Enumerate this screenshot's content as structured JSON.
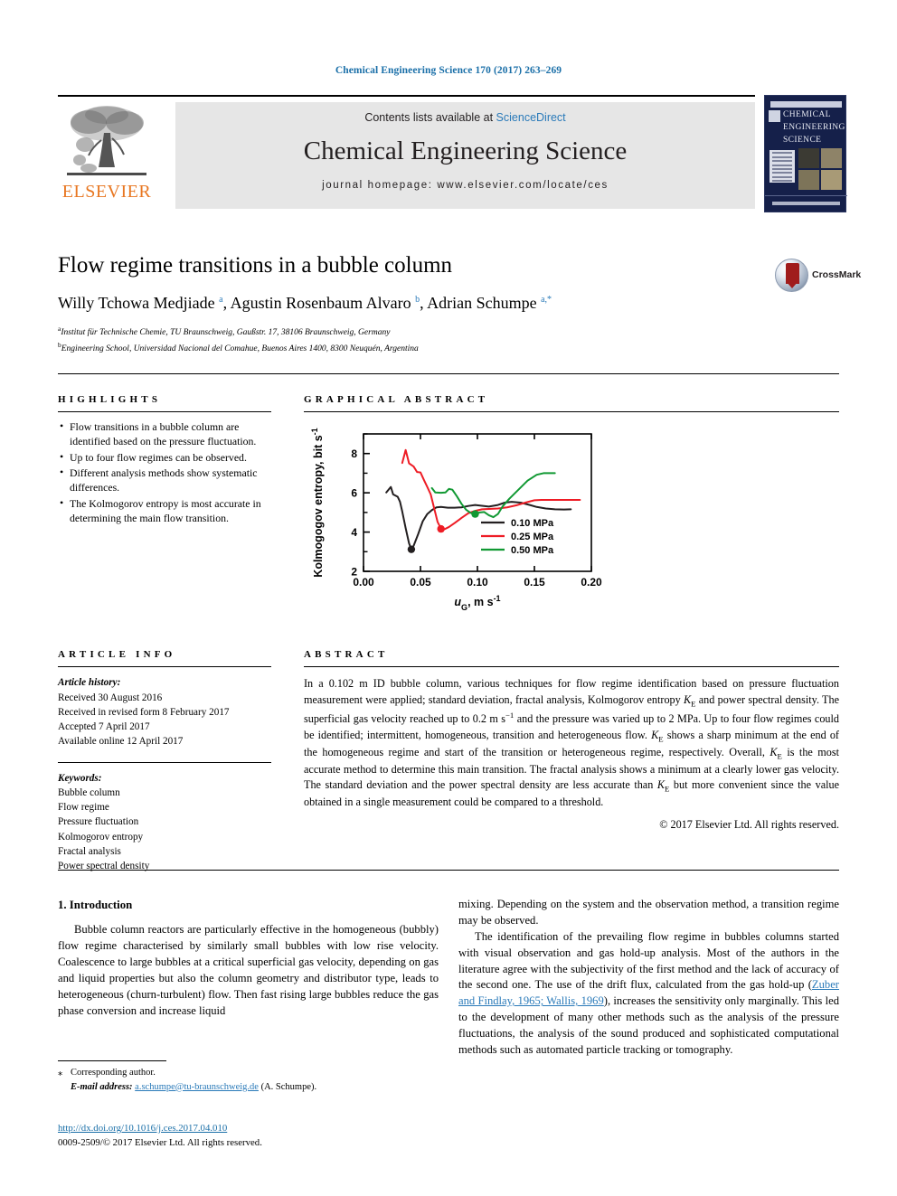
{
  "running_head": "Chemical Engineering Science 170 (2017) 263–269",
  "masthead": {
    "contents_prefix": "Contents lists available at",
    "contents_link": "ScienceDirect",
    "journal_title": "Chemical Engineering Science",
    "homepage": "journal homepage: www.elsevier.com/locate/ces",
    "publisher": "ELSEVIER",
    "cover": {
      "line1": "CHEMICAL",
      "line2": "ENGINEERING",
      "line3": "SCIENCE"
    }
  },
  "article": {
    "title": "Flow regime transitions in a bubble column",
    "authors_html": "Willy Tchowa Medjiade <sup>a</sup>, Agustin Rosenbaum Alvaro <sup>b</sup>, Adrian Schumpe <sup>a,*</sup>",
    "affiliation_a": "Institut für Technische Chemie, TU Braunschweig, Gaußstr. 17, 38106 Braunschweig, Germany",
    "affiliation_b": "Engineering School, Universidad Nacional del Comahue, Buenos Aires 1400, 8300 Neuquén, Argentina",
    "crossmark_label": "CrossMark"
  },
  "highlights": {
    "heading": "HIGHLIGHTS",
    "items": [
      "Flow transitions in a bubble column are identified based on the pressure fluctuation.",
      "Up to four flow regimes can be observed.",
      "Different analysis methods show systematic differences.",
      "The Kolmogorov entropy is most accurate in determining the main flow transition."
    ]
  },
  "graphical_abstract": {
    "heading": "GRAPHICAL ABSTRACT"
  },
  "article_info": {
    "heading": "ARTICLE INFO",
    "history_label": "Article history:",
    "history": [
      "Received 30 August 2016",
      "Received in revised form 8 February 2017",
      "Accepted 7 April 2017",
      "Available online 12 April 2017"
    ],
    "keywords_label": "Keywords:",
    "keywords": [
      "Bubble column",
      "Flow regime",
      "Pressure fluctuation",
      "Kolmogorov entropy",
      "Fractal analysis",
      "Power spectral density"
    ]
  },
  "abstract": {
    "heading": "ABSTRACT",
    "text": "In a 0.102 m ID bubble column, various techniques for flow regime identification based on pressure fluctuation measurement were applied; standard deviation, fractal analysis, Kolmogorov entropy KE and power spectral density. The superficial gas velocity reached up to 0.2 m s−1 and the pressure was varied up to 2 MPa. Up to four flow regimes could be identified; intermittent, homogeneous, transition and heterogeneous flow. KE shows a sharp minimum at the end of the homogeneous regime and start of the transition or heterogeneous regime, respectively. Overall, KE is the most accurate method to determine this main transition. The fractal analysis shows a minimum at a clearly lower gas velocity. The standard deviation and the power spectral density are less accurate than KE but more convenient since the value obtained in a single measurement could be compared to a threshold.",
    "copyright": "© 2017 Elsevier Ltd. All rights reserved."
  },
  "introduction": {
    "heading": "1. Introduction",
    "para1": "Bubble column reactors are particularly effective in the homogeneous (bubbly) flow regime characterised by similarly small bubbles with low rise velocity. Coalescence to large bubbles at a critical superficial gas velocity, depending on gas and liquid properties but also the column geometry and distributor type, leads to heterogeneous (churn-turbulent) flow. Then fast rising large bubbles reduce the gas phase conversion and increase liquid",
    "para1_cont": "mixing. Depending on the system and the observation method, a transition regime may be observed.",
    "para2_a": "The identification of the prevailing flow regime in bubbles columns started with visual observation and gas hold-up analysis. Most of the authors in the literature agree with the subjectivity of the first method and the lack of accuracy of the second one. The use of the drift flux, calculated from the gas hold-up (",
    "para2_link": "Zuber and Findlay, 1965; Wallis, 1969",
    "para2_b": "), increases the sensitivity only marginally. This led to the development of many other methods such as the analysis of the pressure fluctuations, the analysis of the sound produced and sophisticated computational methods such as automated particle tracking or tomography."
  },
  "footnote": {
    "corresponding": "Corresponding author.",
    "email_label": "E-mail address:",
    "email": "a.schumpe@tu-braunschweig.de",
    "email_suffix": "(A. Schumpe)."
  },
  "footer": {
    "doi": "http://dx.doi.org/10.1016/j.ces.2017.04.010",
    "issn_line": "0009-2509/© 2017 Elsevier Ltd. All rights reserved."
  },
  "colors": {
    "link": "#2a7ab9",
    "elsevier_orange": "#E87722",
    "series_black": "#231f20",
    "series_red": "#ee1c25",
    "series_green": "#119933",
    "band_gray": "#e6e6e6"
  },
  "chart_data": {
    "type": "line",
    "title": "",
    "xlabel": "u_G, m s^-1",
    "xlabel_parts": {
      "italic": "u",
      "sub": "G",
      "rest": ", m s",
      "sup": "-1"
    },
    "ylabel": "Kolmogogov entropy, bit s-1",
    "ylabel_parts": {
      "text": "Kolmogogov entropy, bit s",
      "sup": "-1"
    },
    "xlim": [
      0.0,
      0.2
    ],
    "ylim": [
      2,
      9
    ],
    "xticks": [
      0.0,
      0.05,
      0.1,
      0.15,
      0.2
    ],
    "xtick_labels": [
      "0.00",
      "0.05",
      "0.10",
      "0.15",
      "0.20"
    ],
    "yticks": [
      2,
      4,
      6,
      8
    ],
    "ytick_labels": [
      "2",
      "4",
      "6",
      "8"
    ],
    "yticks_minor": [
      3,
      5,
      7,
      9
    ],
    "grid": false,
    "legend_position": "center-right",
    "series": [
      {
        "name": "0.10 MPa",
        "color": "#231f20",
        "points": [
          [
            0.02,
            6.02
          ],
          [
            0.024,
            6.3
          ],
          [
            0.026,
            5.92
          ],
          [
            0.03,
            5.8
          ],
          [
            0.032,
            5.55
          ],
          [
            0.034,
            5.05
          ],
          [
            0.037,
            4.2
          ],
          [
            0.04,
            3.42
          ],
          [
            0.042,
            3.12
          ],
          [
            0.044,
            3.3
          ],
          [
            0.048,
            3.9
          ],
          [
            0.052,
            4.55
          ],
          [
            0.056,
            4.92
          ],
          [
            0.06,
            5.12
          ],
          [
            0.064,
            5.26
          ],
          [
            0.068,
            5.28
          ],
          [
            0.074,
            5.24
          ],
          [
            0.08,
            5.24
          ],
          [
            0.086,
            5.26
          ],
          [
            0.092,
            5.33
          ],
          [
            0.098,
            5.38
          ],
          [
            0.104,
            5.34
          ],
          [
            0.11,
            5.3
          ],
          [
            0.118,
            5.38
          ],
          [
            0.124,
            5.5
          ],
          [
            0.13,
            5.54
          ],
          [
            0.138,
            5.5
          ],
          [
            0.146,
            5.38
          ],
          [
            0.152,
            5.28
          ],
          [
            0.16,
            5.2
          ],
          [
            0.168,
            5.16
          ],
          [
            0.176,
            5.15
          ],
          [
            0.182,
            5.16
          ]
        ],
        "marker_point": [
          0.042,
          3.12
        ]
      },
      {
        "name": "0.25 MPa",
        "color": "#ee1c25",
        "points": [
          [
            0.034,
            7.52
          ],
          [
            0.037,
            8.18
          ],
          [
            0.04,
            7.5
          ],
          [
            0.044,
            7.34
          ],
          [
            0.047,
            7.06
          ],
          [
            0.05,
            7.04
          ],
          [
            0.053,
            6.66
          ],
          [
            0.056,
            6.3
          ],
          [
            0.059,
            5.92
          ],
          [
            0.062,
            5.22
          ],
          [
            0.065,
            4.52
          ],
          [
            0.068,
            4.18
          ],
          [
            0.071,
            4.14
          ],
          [
            0.075,
            4.26
          ],
          [
            0.08,
            4.46
          ],
          [
            0.086,
            4.72
          ],
          [
            0.092,
            4.96
          ],
          [
            0.098,
            5.08
          ],
          [
            0.104,
            5.16
          ],
          [
            0.11,
            5.18
          ],
          [
            0.118,
            5.2
          ],
          [
            0.126,
            5.26
          ],
          [
            0.134,
            5.36
          ],
          [
            0.142,
            5.5
          ],
          [
            0.15,
            5.62
          ],
          [
            0.156,
            5.64
          ],
          [
            0.166,
            5.64
          ],
          [
            0.178,
            5.64
          ],
          [
            0.19,
            5.64
          ]
        ],
        "marker_point": [
          0.068,
          4.16
        ]
      },
      {
        "name": "0.50 MPa",
        "color": "#119933",
        "points": [
          [
            0.06,
            6.24
          ],
          [
            0.063,
            6.02
          ],
          [
            0.068,
            6.0
          ],
          [
            0.072,
            6.02
          ],
          [
            0.075,
            6.2
          ],
          [
            0.078,
            6.16
          ],
          [
            0.082,
            5.82
          ],
          [
            0.086,
            5.44
          ],
          [
            0.09,
            5.14
          ],
          [
            0.094,
            4.98
          ],
          [
            0.098,
            4.92
          ],
          [
            0.102,
            5.0
          ],
          [
            0.106,
            5.02
          ],
          [
            0.11,
            4.86
          ],
          [
            0.114,
            4.76
          ],
          [
            0.118,
            4.92
          ],
          [
            0.122,
            5.3
          ],
          [
            0.128,
            5.7
          ],
          [
            0.136,
            6.16
          ],
          [
            0.144,
            6.62
          ],
          [
            0.152,
            6.92
          ],
          [
            0.158,
            7.0
          ],
          [
            0.168,
            7.0
          ]
        ],
        "marker_point": [
          0.098,
          4.92
        ]
      }
    ]
  }
}
